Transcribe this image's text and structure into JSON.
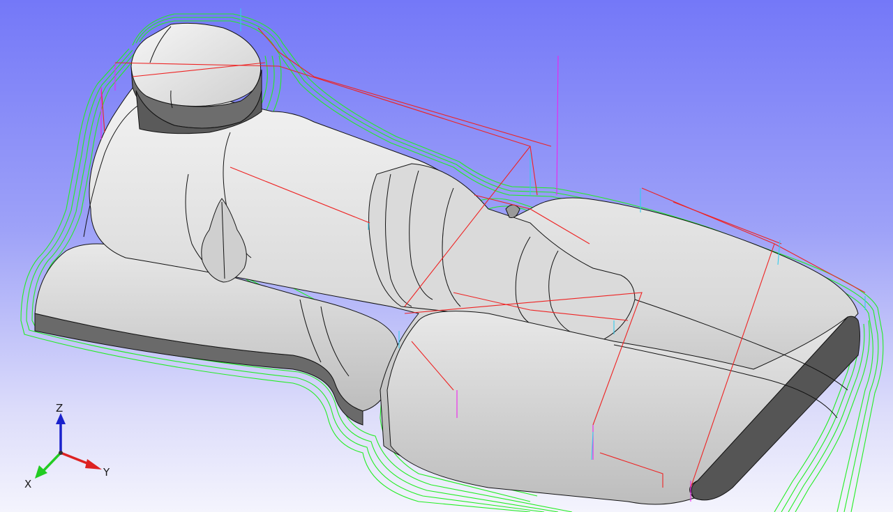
{
  "viewport": {
    "background_top": "#7478f8",
    "background_bottom": "#f4f4fd"
  },
  "model": {
    "surface_color": "#e2e2e2",
    "edge_color": "#111111",
    "shadow_color": "#4a4a4a"
  },
  "toolpaths": {
    "cut_color": "#22ee22",
    "rapid_color": "#ee2222",
    "plunge_color": "#ee22ee",
    "lead_color": "#33ccee"
  },
  "triad": {
    "z_label": "Z",
    "y_label": "Y",
    "x_label": "X",
    "z_color": "#1a22cc",
    "y_color": "#dd2222",
    "x_color": "#22cc22"
  }
}
